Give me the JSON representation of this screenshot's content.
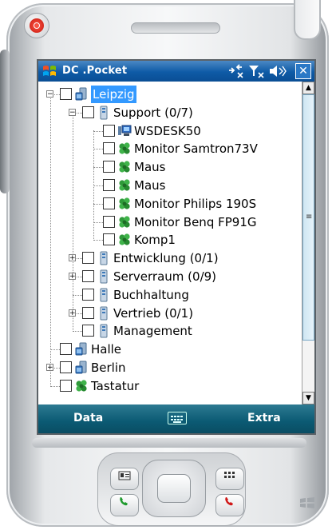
{
  "window": {
    "title": "DC .Pocket",
    "icons": [
      "connectivity-icon",
      "signal-icon",
      "volume-icon",
      "close-icon"
    ]
  },
  "tree": {
    "rows": [
      {
        "id": "leipzig",
        "label": "Leipzig",
        "level": 0,
        "expander": "minus",
        "icon": "group-icon",
        "selected": true
      },
      {
        "id": "support",
        "label": "Support (0/7)",
        "level": 1,
        "expander": "minus",
        "icon": "server-icon"
      },
      {
        "id": "wsdesk50",
        "label": "WSDESK50",
        "level": 2,
        "expander": "",
        "icon": "computer-icon"
      },
      {
        "id": "monitor-samtron",
        "label": "Monitor Samtron73V",
        "level": 2,
        "expander": "",
        "icon": "device-icon"
      },
      {
        "id": "maus-1",
        "label": "Maus",
        "level": 2,
        "expander": "",
        "icon": "device-icon"
      },
      {
        "id": "maus-2",
        "label": "Maus",
        "level": 2,
        "expander": "",
        "icon": "device-icon"
      },
      {
        "id": "monitor-philips",
        "label": "Monitor Philips 190S",
        "level": 2,
        "expander": "",
        "icon": "device-icon"
      },
      {
        "id": "monitor-benq",
        "label": "Monitor Benq FP91G",
        "level": 2,
        "expander": "",
        "icon": "device-icon"
      },
      {
        "id": "komp1",
        "label": "Komp1",
        "level": 2,
        "expander": "",
        "icon": "device-icon"
      },
      {
        "id": "entwicklung",
        "label": "Entwicklung (0/1)",
        "level": 1,
        "expander": "plus",
        "icon": "server-icon"
      },
      {
        "id": "serverraum",
        "label": "Serverraum (0/9)",
        "level": 1,
        "expander": "plus",
        "icon": "server-icon"
      },
      {
        "id": "buchhaltung",
        "label": "Buchhaltung",
        "level": 1,
        "expander": "",
        "icon": "server-icon"
      },
      {
        "id": "vertrieb",
        "label": "Vertrieb (0/1)",
        "level": 1,
        "expander": "plus",
        "icon": "server-icon"
      },
      {
        "id": "management",
        "label": "Management",
        "level": 1,
        "expander": "",
        "icon": "server-icon"
      },
      {
        "id": "halle",
        "label": "Halle",
        "level": 0,
        "expander": "",
        "icon": "group-icon"
      },
      {
        "id": "berlin",
        "label": "Berlin",
        "level": 0,
        "expander": "plus",
        "icon": "group-icon"
      },
      {
        "id": "tastatur",
        "label": "Tastatur",
        "level": 0,
        "expander": "",
        "icon": "device-icon"
      }
    ]
  },
  "menubar": {
    "left_label": "Data",
    "right_label": "Extra",
    "keyboard_icon": "keyboard-icon"
  },
  "colors": {
    "titlebar": "#0e5aa6",
    "menubar": "#0b5a73",
    "selection": "#3399ff"
  }
}
